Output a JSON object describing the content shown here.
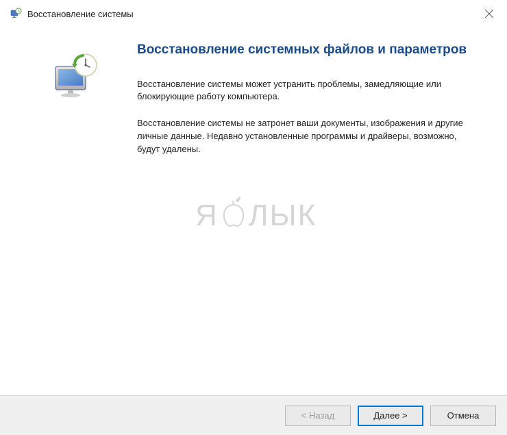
{
  "window": {
    "title": "Восстановление системы"
  },
  "content": {
    "heading": "Восстановление системных файлов и параметров",
    "paragraph1": "Восстановление системы может устранить проблемы, замедляющие или блокирующие работу компьютера.",
    "paragraph2": "Восстановление системы не затронет ваши документы, изображения и другие личные данные. Недавно установленные программы и драйверы, возможно, будут удалены."
  },
  "watermark": {
    "text_before": "Я",
    "text_after": "ЛЫК"
  },
  "buttons": {
    "back": "< Назад",
    "next": "Далее >",
    "cancel": "Отмена"
  }
}
